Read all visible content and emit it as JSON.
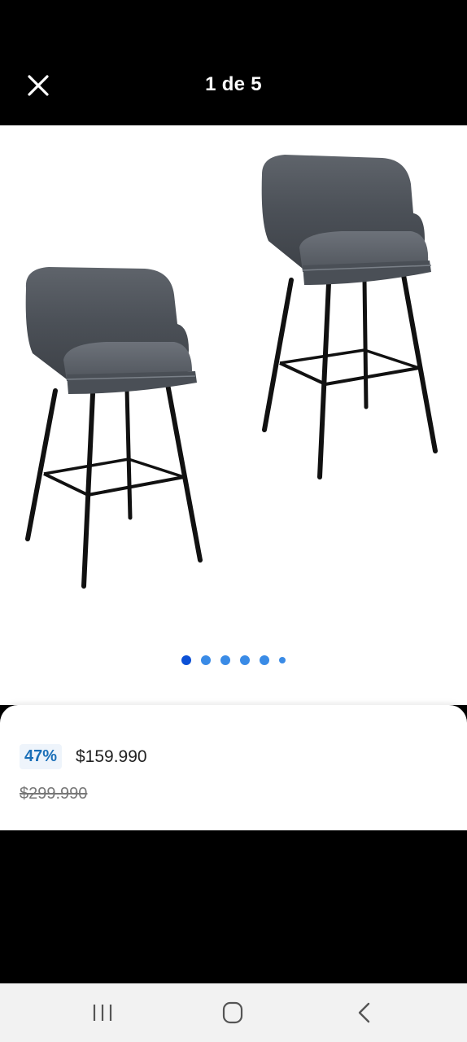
{
  "header": {
    "title": "1 de 5",
    "close_icon": "close-icon"
  },
  "gallery": {
    "image": "bar-stools-product-image",
    "dots_total": 6,
    "active_index": 0
  },
  "pricing": {
    "discount": "47%",
    "current_price": "$159.990",
    "original_price": "$299.990"
  },
  "navbar": {
    "items": [
      "recent-apps-icon",
      "home-icon",
      "back-icon"
    ]
  },
  "colors": {
    "discount_text": "#1a6fb8",
    "discount_bg": "#eef4fb",
    "dot_active": "#0b50d6",
    "dot_inactive": "#3a8be6"
  }
}
